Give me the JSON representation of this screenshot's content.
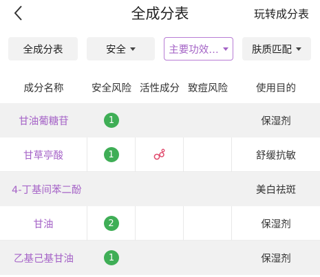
{
  "header": {
    "title": "全成分表",
    "right_link": "玩转成分表",
    "back_icon": "chevron-left-icon"
  },
  "filters": [
    {
      "label": "全成分表",
      "dropdown": false,
      "active": false
    },
    {
      "label": "安全",
      "dropdown": true,
      "active": false
    },
    {
      "label": "主要功效…",
      "dropdown": true,
      "active": true
    },
    {
      "label": "肤质匹配",
      "dropdown": true,
      "active": false
    }
  ],
  "table": {
    "columns": [
      "成分名称",
      "安全风险",
      "活性成分",
      "致痘风险",
      "使用目的"
    ],
    "rows": [
      {
        "name": "甘油葡糖苷",
        "safety": "1",
        "purpose": "保湿剂"
      },
      {
        "name": "甘草亭酸",
        "safety": "1",
        "active_icon": "molecule-icon",
        "purpose": "舒缓抗敏"
      },
      {
        "name": "4-丁基间苯二酚",
        "purpose": "美白祛斑"
      },
      {
        "name": "甘油",
        "safety": "2",
        "purpose": "保湿剂"
      },
      {
        "name": "乙基己基甘油",
        "safety": "1",
        "purpose": "保湿剂"
      }
    ]
  },
  "colors": {
    "accent": "#a563c7",
    "safety_green": "#3fae56",
    "row_shade": "#f1f1f1",
    "active_icon": "#e0476a"
  }
}
